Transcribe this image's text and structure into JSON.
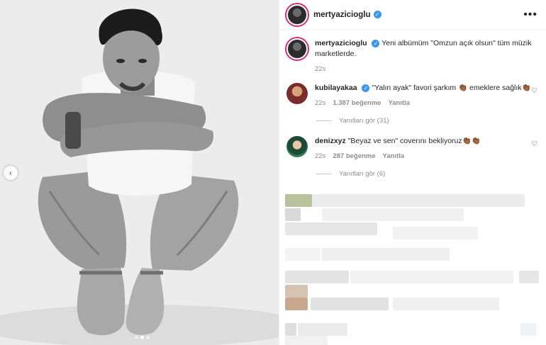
{
  "post": {
    "username": "mertyazicioglu",
    "verified_mark": "✓",
    "more_label": "•••",
    "caption_user": "mertyazicioglu",
    "caption_text": "Yeni albümüm \"Omzun açık olsun\" tüm müzik marketlerde.",
    "caption_time": "22s"
  },
  "comments": [
    {
      "user": "kubilayakaa",
      "text": "\"Yalın ayak\" favori şarkım 👏🏾 emeklere sağlık👏🏾",
      "time": "22s",
      "likes": "1.387 beğenme",
      "reply": "Yanıtla",
      "view_replies": "Yanıtları gör (31)"
    },
    {
      "user": "denizxyz",
      "text": "\"Beyaz ve sen\" coverını bekliyoruz👏🏾👏🏾",
      "time": "22s",
      "likes": "287 beğenme",
      "reply": "Yanıtla",
      "view_replies": "Yanıtları gör (6)"
    }
  ],
  "icons": {
    "prev": "‹",
    "heart": "♡"
  },
  "colors": {
    "accent": "#3897f0",
    "story_ring": "#d62976"
  }
}
